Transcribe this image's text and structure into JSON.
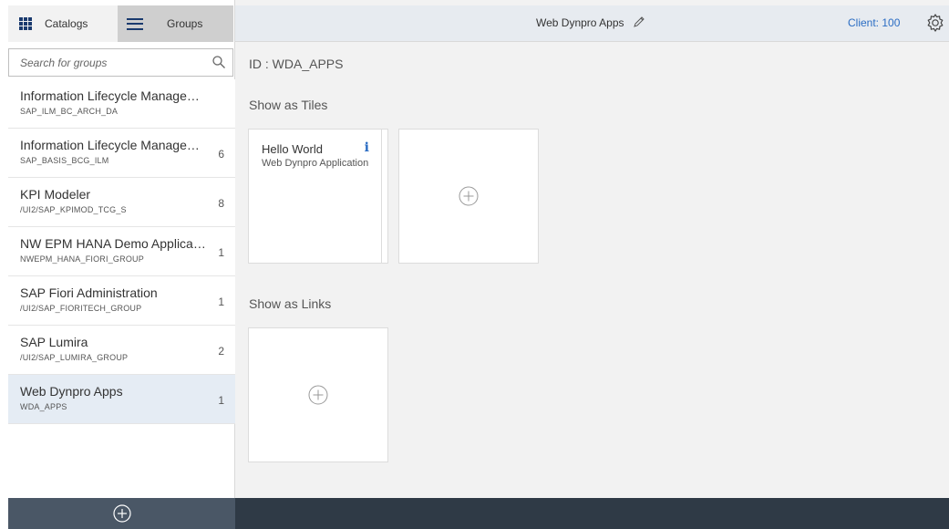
{
  "tabs": {
    "catalogs_label": "Catalogs",
    "groups_label": "Groups"
  },
  "search": {
    "placeholder": "Search for groups",
    "value": ""
  },
  "groups": [
    {
      "title": "Information Lifecycle Management",
      "id": "SAP_ILM_BC_ARCH_DA",
      "count": ""
    },
    {
      "title": "Information Lifecycle Management",
      "id": "SAP_BASIS_BCG_ILM",
      "count": "6"
    },
    {
      "title": "KPI Modeler",
      "id": "/UI2/SAP_KPIMOD_TCG_S",
      "count": "8"
    },
    {
      "title": "NW EPM HANA Demo Applications",
      "id": "NWEPM_HANA_FIORI_GROUP",
      "count": "1"
    },
    {
      "title": "SAP Fiori Administration",
      "id": "/UI2/SAP_FIORITECH_GROUP",
      "count": "1"
    },
    {
      "title": "SAP Lumira",
      "id": "/UI2/SAP_LUMIRA_GROUP",
      "count": "2"
    },
    {
      "title": "Web Dynpro Apps",
      "id": "WDA_APPS",
      "count": "1",
      "selected": true
    }
  ],
  "header": {
    "title": "Web Dynpro Apps",
    "client": "Client: 100"
  },
  "main": {
    "id_label": "ID : WDA_APPS",
    "tiles_section": "Show as Tiles",
    "links_section": "Show as Links",
    "tile": {
      "title": "Hello World",
      "subtitle": "Web Dynpro Application",
      "info_glyph": "i"
    }
  },
  "icons": {
    "catalogs": "grid-icon",
    "groups": "menu-icon",
    "search": "search-icon",
    "edit": "pencil-icon",
    "settings": "gear-icon",
    "add": "plus-circle-icon",
    "info": "info-icon"
  },
  "colors": {
    "accent": "#2a6cc3",
    "selected_row": "#e5ecf4",
    "footer": "#2f3a46",
    "sidebar_footer": "#4a5766",
    "header_bg": "#e7ebf0"
  }
}
